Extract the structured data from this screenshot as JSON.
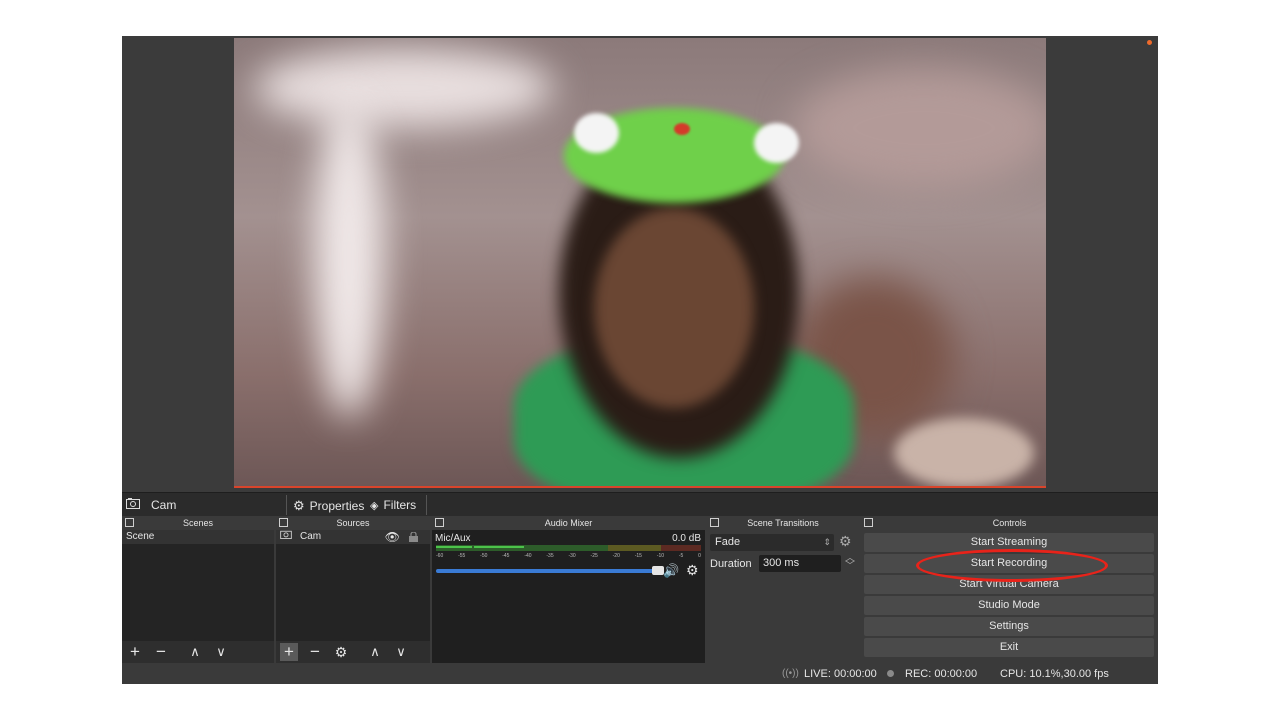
{
  "source_bar": {
    "source_name": "Cam",
    "properties_label": "Properties",
    "filters_label": "Filters"
  },
  "scenes": {
    "title": "Scenes",
    "items": [
      "Scene"
    ]
  },
  "sources": {
    "title": "Sources",
    "items": [
      "Cam"
    ]
  },
  "audio_mixer": {
    "title": "Audio Mixer",
    "channel": "Mic/Aux",
    "level": "0.0 dB",
    "ticks": [
      "-60",
      "-55",
      "-50",
      "-45",
      "-40",
      "-35",
      "-30",
      "-25",
      "-20",
      "-15",
      "-10",
      "-5",
      "0"
    ],
    "volume_fraction": 1.0
  },
  "scene_transitions": {
    "title": "Scene Transitions",
    "selected": "Fade",
    "duration_label": "Duration",
    "duration_value": "300 ms"
  },
  "controls": {
    "title": "Controls",
    "buttons": [
      "Start Streaming",
      "Start Recording",
      "Start Virtual Camera",
      "Studio Mode",
      "Settings",
      "Exit"
    ]
  },
  "status": {
    "live": "LIVE: 00:00:00",
    "rec": "REC: 00:00:00",
    "cpu": "CPU: 10.1%,30.00 fps"
  },
  "colors": {
    "accent_recording": "#e8231a",
    "preview_border": "#d9442b",
    "meter_green": "#4cc34a",
    "volume_blue": "#3a7bd5"
  }
}
